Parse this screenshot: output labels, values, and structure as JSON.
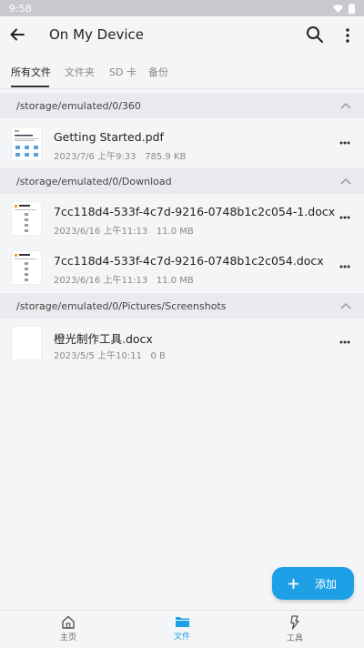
{
  "status_bar": {
    "time": "9:58"
  },
  "app_bar": {
    "title": "On My Device"
  },
  "tabs": [
    {
      "label": "所有文件",
      "active": true
    },
    {
      "label": "文件夹",
      "active": false
    },
    {
      "label": "SD 卡",
      "active": false
    },
    {
      "label": "备份",
      "active": false
    }
  ],
  "groups": [
    {
      "path": "/storage/emulated/0/360",
      "files": [
        {
          "name": "Getting Started.pdf",
          "date": "2023/7/6 上午9:33",
          "size": "785.9 KB",
          "thumb": "pdf"
        }
      ]
    },
    {
      "path": "/storage/emulated/0/Download",
      "files": [
        {
          "name": "7cc118d4-533f-4c7d-9216-0748b1c2c054-1.docx",
          "date": "2023/6/16 上午11:13",
          "size": "11.0 MB",
          "thumb": "doc"
        },
        {
          "name": "7cc118d4-533f-4c7d-9216-0748b1c2c054.docx",
          "date": "2023/6/16 上午11:13",
          "size": "11.0 MB",
          "thumb": "doc"
        }
      ]
    },
    {
      "path": "/storage/emulated/0/Pictures/Screenshots",
      "files": [
        {
          "name": "橙光制作工具.docx",
          "date": "2023/5/5 上午10:11",
          "size": "0 B",
          "thumb": "blank"
        }
      ]
    }
  ],
  "fab": {
    "label": "添加",
    "icon": "plus-icon"
  },
  "bottom_nav": [
    {
      "label": "主页",
      "icon": "home-icon",
      "active": false
    },
    {
      "label": "文件",
      "icon": "folder-icon",
      "active": true
    },
    {
      "label": "工具",
      "icon": "tools-icon",
      "active": false
    }
  ],
  "colors": {
    "accent": "#1ea0e6",
    "background": "#f4f5f7",
    "group_header": "#e9eaed"
  }
}
